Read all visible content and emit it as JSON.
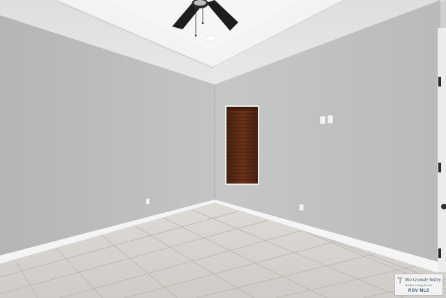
{
  "photo": {
    "kind": "real-estate interior photo",
    "subject": "empty bedroom with tray ceiling, ceiling fan, single window with wood blinds, light gray walls, white baseboards and beige ceramic tile floor",
    "icons": [
      "ceiling-fan-icon",
      "recessed-light-icon",
      "window-blinds-icon",
      "light-switch-icon",
      "electrical-outlet-icon",
      "door-hinge-icon",
      "palm-tree-icon"
    ],
    "colors": {
      "wall_left": "#b7b8b8",
      "wall_right": "#c4c5c5",
      "ceiling": "#e3e3e3",
      "tray": "#f2f2f2",
      "floor": "#d7d4cf",
      "blinds": "#5a2a16",
      "trim": "#f4f4f4"
    }
  },
  "watermark": {
    "brand": "Rio Grande Valley",
    "tagline": "Multiple Listing Service",
    "mls": "RGV MLS"
  }
}
